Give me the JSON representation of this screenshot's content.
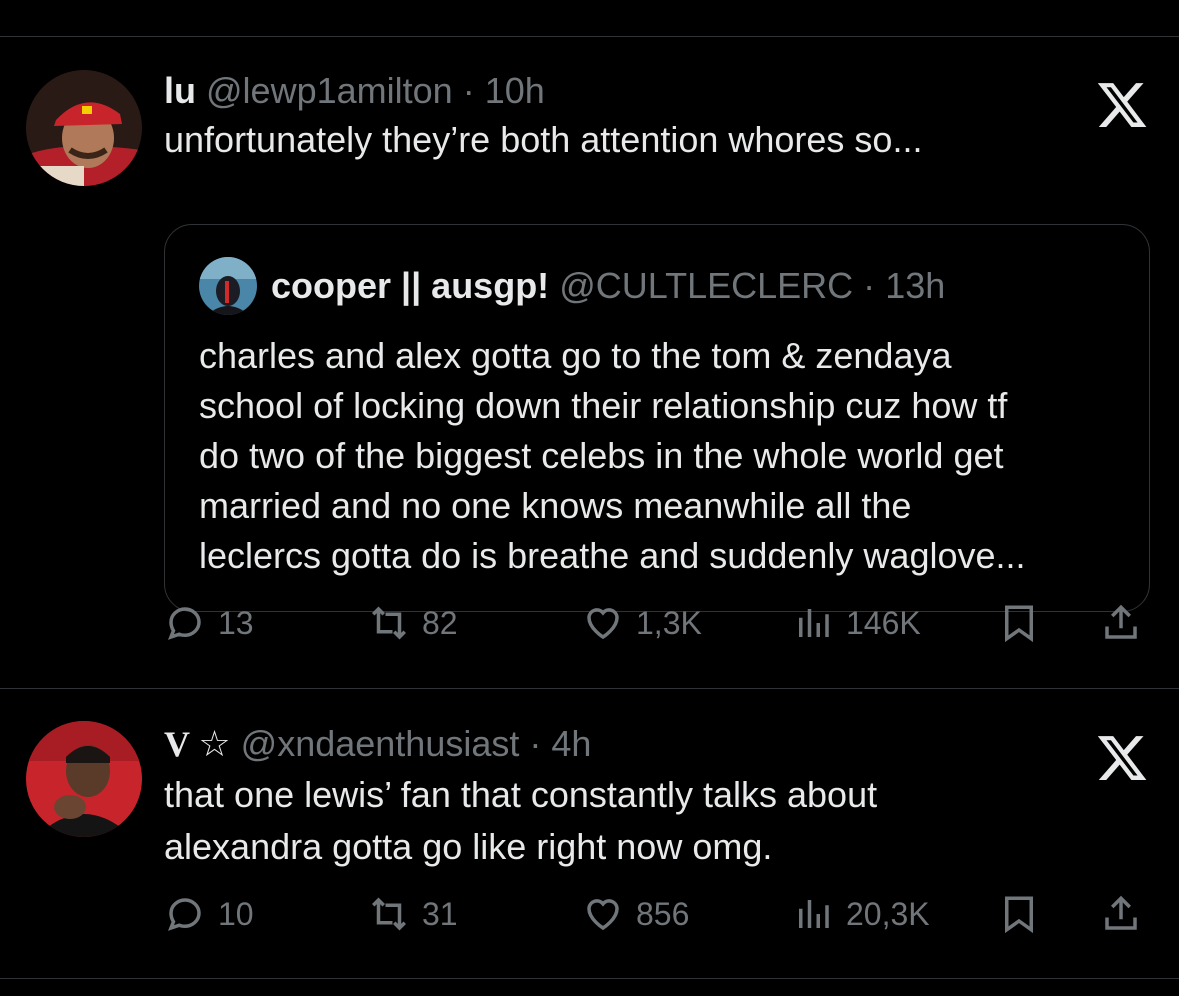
{
  "tweet1": {
    "display_name": "lu",
    "handle": "@lewp1amilton",
    "separator": "·",
    "time": "10h",
    "text": "unfortunately they’re both attention whores so...",
    "quote": {
      "display_name": "cooper || ausgp!",
      "handle": "@CULTLECLERC",
      "separator": "·",
      "time": "13h",
      "text": "charles and alex gotta go to the tom & zendaya\nschool of locking down their relationship cuz how tf\ndo two of the biggest celebs in the whole world get\nmarried and no one knows meanwhile all the\nleclercs gotta do is breathe and suddenly waglove..."
    },
    "replies": "13",
    "reposts": "82",
    "likes": "1,3K",
    "views": "146K"
  },
  "tweet2": {
    "display_name": "V",
    "star": "☆",
    "handle": "@xndaenthusiast",
    "separator": "·",
    "time": "4h",
    "text": "that one lewis’ fan that constantly talks about\nalexandra gotta go like right now omg.",
    "replies": "10",
    "reposts": "31",
    "likes": "856",
    "views": "20,3K"
  },
  "icons": {
    "reply": "reply-icon",
    "repost": "repost-icon",
    "like": "heart-icon",
    "views": "views-icon",
    "bookmark": "bookmark-icon",
    "share": "share-icon",
    "close": "x-logo-icon"
  },
  "colors": {
    "background": "#000000",
    "text": "#e7e9ea",
    "muted": "#71767b",
    "border": "#2f3336",
    "avatar1": "#b3202a",
    "avatar2": "#c8242c"
  }
}
